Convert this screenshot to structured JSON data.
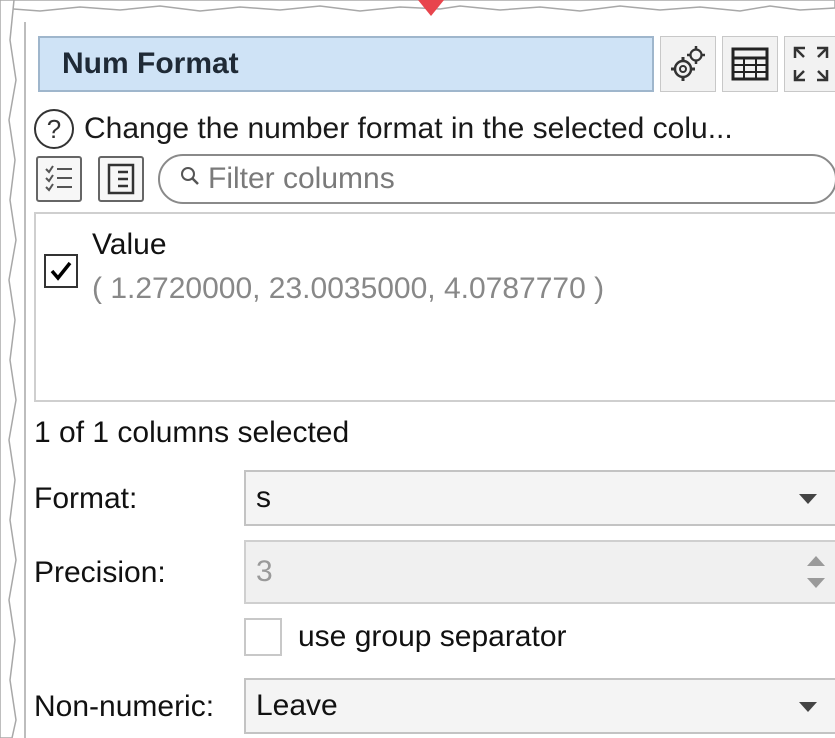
{
  "panel": {
    "title": "Num Format",
    "description": "Change the number format in the selected colu...",
    "filter_placeholder": "Filter columns"
  },
  "icons": {
    "help": "help-circle-icon",
    "settings": "gears-icon",
    "table": "table-icon",
    "expand": "expand-icon",
    "check_all": "checklist-icon",
    "list": "list-icon",
    "search": "search-icon"
  },
  "columns": [
    {
      "name": "Value",
      "sample": "( 1.2720000, 23.0035000, 4.0787770 )",
      "checked": true
    }
  ],
  "selection_status": "1 of 1 columns selected",
  "form": {
    "format_label": "Format:",
    "format_value": "s",
    "precision_label": "Precision:",
    "precision_value": "3",
    "group_separator_label": "use group separator",
    "non_numeric_label": "Non-numeric:",
    "non_numeric_value": "Leave"
  },
  "colors": {
    "title_bg": "#cfe3f6",
    "title_border": "#9fb6cc",
    "arrow_marker": "#e8454d"
  }
}
